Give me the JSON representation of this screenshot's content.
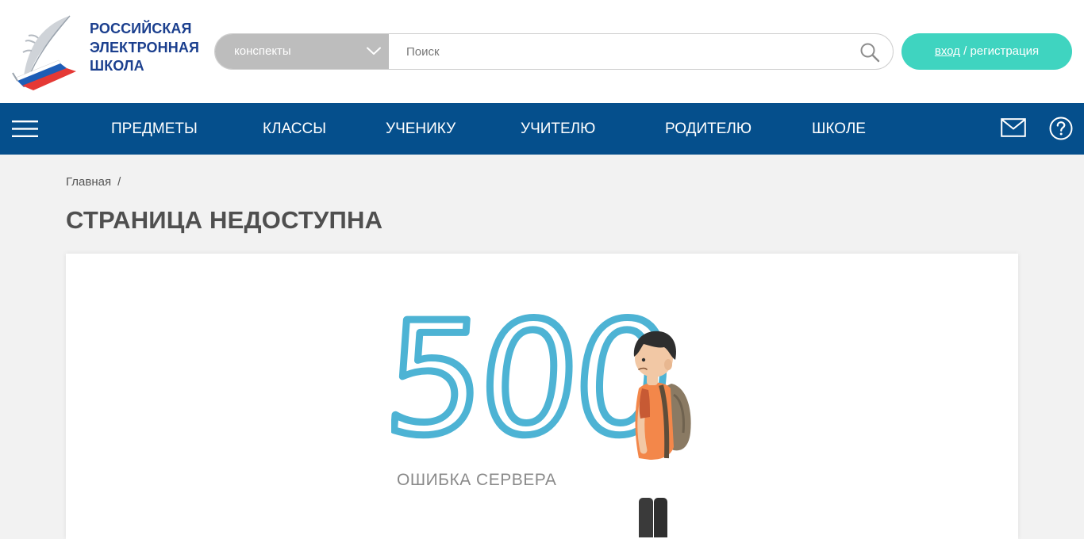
{
  "header": {
    "logo": {
      "line1": "РОССИЙСКАЯ",
      "line2": "ЭЛЕКТРОННАЯ",
      "line3": "ШКОЛА"
    },
    "search": {
      "category": "конспекты",
      "placeholder": "Поиск"
    },
    "login": {
      "link": "вход",
      "rest": " / регистрация"
    }
  },
  "nav": {
    "items": [
      {
        "label": "ПРЕДМЕТЫ"
      },
      {
        "label": "КЛАССЫ"
      },
      {
        "label": "УЧЕНИКУ"
      },
      {
        "label": "УЧИТЕЛЮ"
      },
      {
        "label": "РОДИТЕЛЮ"
      },
      {
        "label": "ШКОЛЕ"
      }
    ]
  },
  "breadcrumb": {
    "home": "Главная",
    "separator": "/"
  },
  "page": {
    "title": "СТРАНИЦА НЕДОСТУПНА",
    "error_code": "500",
    "error_caption": "ОШИБКА СЕРВЕРА"
  },
  "colors": {
    "navbar": "#054f8c",
    "login_button": "#3fd4c0",
    "logo_text": "#1b3f8e",
    "error_code": "#4db3d4"
  },
  "icons": [
    "chevron-down-icon",
    "search-icon",
    "menu-icon",
    "mail-icon",
    "help-icon"
  ]
}
